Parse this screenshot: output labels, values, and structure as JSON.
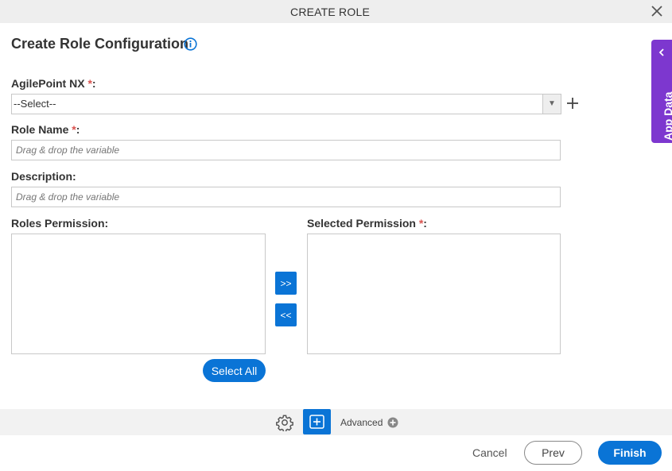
{
  "dialog": {
    "title": "CREATE ROLE",
    "heading": "Create Role Configuration"
  },
  "form": {
    "agilepoint_label": "AgilePoint NX",
    "agilepoint_selected": "--Select--",
    "role_name_label": "Role Name",
    "role_name_placeholder": "Drag & drop the variable",
    "description_label": "Description",
    "description_placeholder": "Drag & drop the variable",
    "roles_permission_label": "Roles Permission:",
    "selected_permission_label": "Selected Permission",
    "required_mark": "*",
    "colon": ":",
    "move_right": ">>",
    "move_left": "<<",
    "select_all": "Select All"
  },
  "side_tab": {
    "label": "App Data"
  },
  "toolbar": {
    "advanced_label": "Advanced"
  },
  "footer": {
    "cancel": "Cancel",
    "prev": "Prev",
    "finish": "Finish"
  },
  "colors": {
    "primary": "#0a74d6",
    "side_tab": "#7d37cf",
    "required": "#d9534f"
  },
  "icons": [
    "close-icon",
    "info-icon",
    "plus-icon",
    "chevron-left-icon",
    "gear-icon",
    "add-step-icon",
    "plus-circle-icon",
    "dropdown-arrow-icon"
  ]
}
